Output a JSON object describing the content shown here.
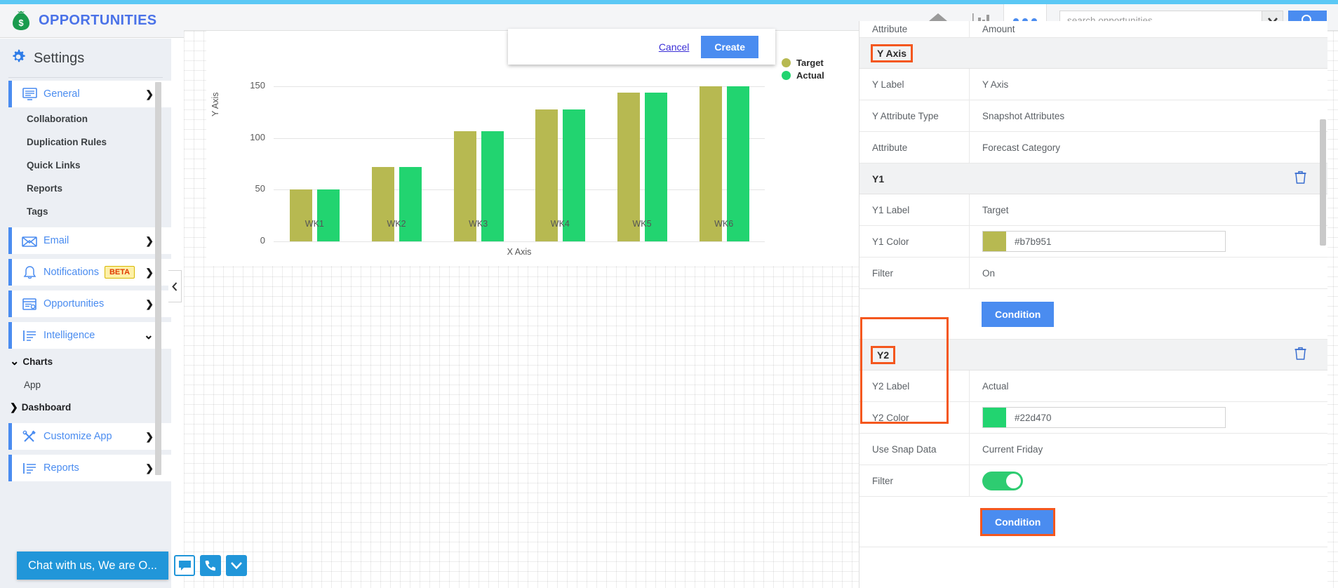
{
  "header": {
    "brand_title": "OPPORTUNITIES",
    "icons": [
      {
        "name": "home-icon",
        "label": "Home"
      },
      {
        "name": "chart-icon",
        "label": "Analytics"
      },
      {
        "name": "more-icon",
        "label": "More"
      }
    ],
    "search": {
      "placeholder": "search opportunities",
      "value": "",
      "caret": "▼",
      "button_icon": "search-icon"
    },
    "accent_color": "#4a8cf0"
  },
  "sidebar": {
    "title": "Settings",
    "items": [
      {
        "label": "General",
        "icon": "monitor-icon",
        "arrow": "❯",
        "badge": null
      },
      {
        "label": "Email",
        "icon": "envelope-icon",
        "arrow": "❯",
        "badge": null
      },
      {
        "label": "Notifications",
        "icon": "bell-icon",
        "arrow": "❯",
        "badge": "BETA"
      },
      {
        "label": "Opportunities",
        "icon": "window-icon",
        "arrow": "❯",
        "badge": null
      },
      {
        "label": "Intelligence",
        "icon": "list-icon",
        "arrow": "⌄",
        "badge": null
      },
      {
        "label": "Customize App",
        "icon": "tools-icon",
        "arrow": "❯",
        "badge": null
      },
      {
        "label": "Reports",
        "icon": "list-icon",
        "arrow": "❯",
        "badge": null
      }
    ],
    "general_children": [
      "Collaboration",
      "Duplication Rules",
      "Quick Links",
      "Reports",
      "Tags"
    ],
    "intelligence_children": [
      {
        "label": "Charts",
        "arrow": "⌄",
        "expanded": true
      },
      {
        "label": "App",
        "arrow": "",
        "expanded": false
      },
      {
        "label": "Dashboard",
        "arrow": "❯",
        "expanded": false
      }
    ],
    "collapse_handle_icon": "chevron-left-icon"
  },
  "create_popup": {
    "cancel_label": "Cancel",
    "create_label": "Create"
  },
  "chart_data": {
    "type": "bar",
    "title": "",
    "categories": [
      "WK1",
      "WK2",
      "WK3",
      "WK4",
      "WK5",
      "WK6"
    ],
    "series": [
      {
        "name": "Target",
        "color": "#b7b951",
        "values": [
          50,
          72,
          107,
          128,
          144,
          150
        ]
      },
      {
        "name": "Actual",
        "color": "#22d470",
        "values": [
          50,
          72,
          107,
          128,
          144,
          150
        ]
      }
    ],
    "xlabel": "X Axis",
    "ylabel": "Y Axis",
    "yticks": [
      0,
      50,
      100,
      150
    ],
    "ylim": [
      0,
      178
    ],
    "grid": true,
    "legend_position": "right"
  },
  "properties": {
    "top_partial": {
      "label": "Attribute",
      "value": "Amount"
    },
    "sections": [
      {
        "name": "Y Axis",
        "highlighted": true,
        "deletable": false,
        "rows": [
          {
            "label": "Y Label",
            "value": "Y Axis",
            "type": "text"
          },
          {
            "label": "Y Attribute Type",
            "value": "Snapshot Attributes",
            "type": "text"
          },
          {
            "label": "Attribute",
            "value": "Forecast Category",
            "type": "text"
          }
        ]
      },
      {
        "name": "Y1",
        "highlighted": false,
        "deletable": true,
        "rows": [
          {
            "label": "Y1 Label",
            "value": "Target",
            "type": "text"
          },
          {
            "label": "Y1 Color",
            "value": "#b7b951",
            "type": "color"
          },
          {
            "label": "Filter",
            "value": "On",
            "type": "text"
          }
        ],
        "condition_label": "Condition",
        "condition_highlighted": false
      },
      {
        "name": "Y2",
        "highlighted": true,
        "deletable": true,
        "group_highlighted": true,
        "rows": [
          {
            "label": "Y2 Label",
            "value": "Actual",
            "type": "text"
          },
          {
            "label": "Y2 Color",
            "value": "#22d470",
            "type": "color"
          },
          {
            "label": "Use Snap Data",
            "value": "Current Friday",
            "type": "text"
          },
          {
            "label": "Filter",
            "value": "",
            "type": "toggle",
            "toggle_on": true
          }
        ],
        "condition_label": "Condition",
        "condition_highlighted": true
      }
    ],
    "trash_icon": "trash-icon",
    "highlight_color": "#f4571e"
  },
  "chat": {
    "message": "Chat with us, We are O...",
    "buttons": [
      {
        "name": "chat-bubble-icon"
      },
      {
        "name": "phone-icon"
      },
      {
        "name": "chevron-down-icon"
      }
    ],
    "color": "#2196d9"
  }
}
